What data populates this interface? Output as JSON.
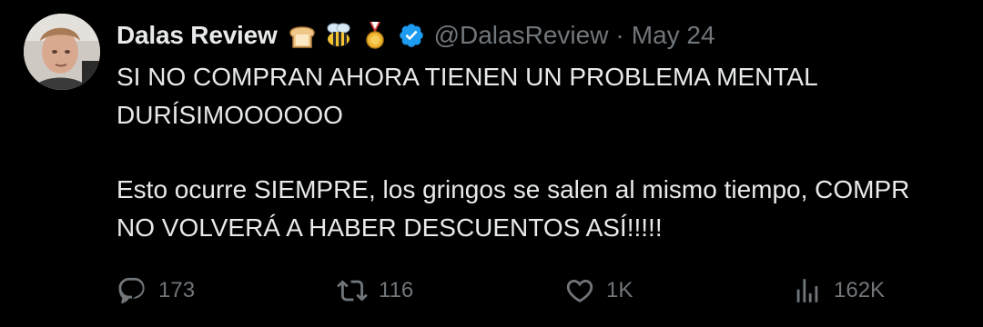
{
  "author": {
    "display_name": "Dalas Review",
    "handle": "@DalasReview",
    "separator": "·",
    "date": "May 24",
    "name_emojis": [
      "bread-icon",
      "bee-icon",
      "medal-icon"
    ],
    "verified_color": "#1d9bf0"
  },
  "tweet": {
    "line1": "SI NO COMPRAN AHORA TIENEN UN PROBLEMA MENTAL",
    "line2": "DURÍSIMOOOOOO",
    "line3": "Esto ocurre SIEMPRE, los gringos se salen al mismo tiempo, COMPR",
    "line4": "NO VOLVERÁ A HABER DESCUENTOS ASÍ!!!!!"
  },
  "actions": {
    "replies": "173",
    "retweets": "116",
    "likes": "1K",
    "views": "162K"
  },
  "colors": {
    "background": "#000000",
    "text": "#e7e9ea",
    "muted": "#71767b"
  }
}
